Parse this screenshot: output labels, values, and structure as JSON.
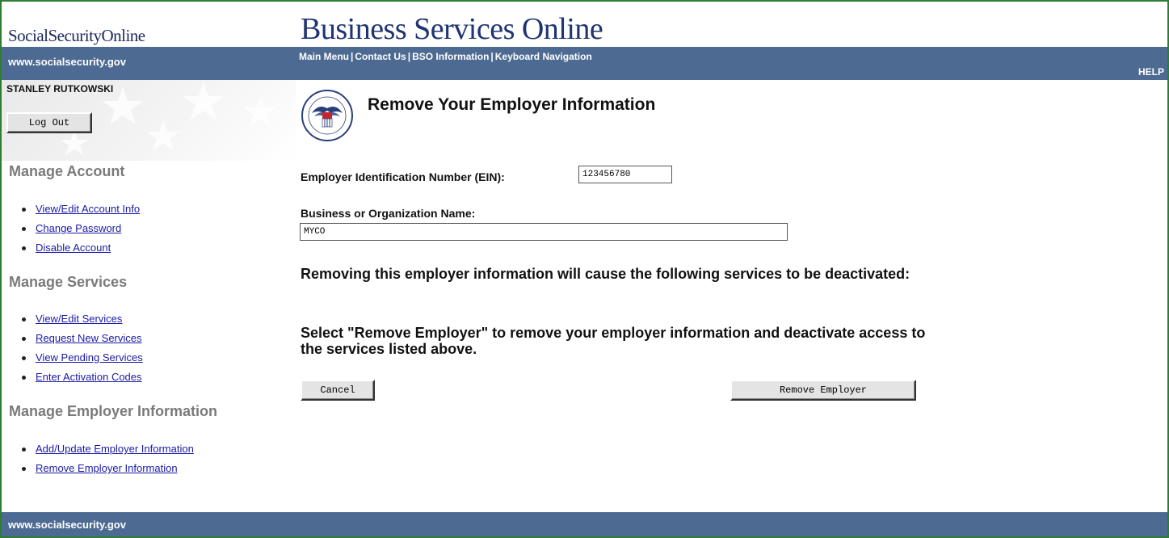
{
  "header": {
    "brand": "SocialSecurityOnline",
    "title": "Business Services Online",
    "url": "www.socialsecurity.gov",
    "nav": [
      "Main Menu",
      "Contact Us",
      "BSO Information",
      "Keyboard Navigation"
    ],
    "nav_separator": "|",
    "help": "HELP"
  },
  "sidebar": {
    "username": "STANLEY RUTKOWSKI",
    "logout_label": "Log Out",
    "sections": [
      {
        "heading": "Manage Account",
        "items": [
          "View/Edit Account Info",
          "Change Password",
          "Disable Account"
        ]
      },
      {
        "heading": "Manage Services",
        "items": [
          "View/Edit Services",
          "Request New Services",
          "View Pending Services",
          "Enter Activation Codes"
        ]
      },
      {
        "heading": "Manage Employer Information",
        "items": [
          "Add/Update Employer Information",
          "Remove Employer Information"
        ]
      }
    ]
  },
  "main": {
    "title": "Remove Your Employer Information",
    "ein_label": "Employer Identification Number (EIN):",
    "ein_value": "123456780",
    "name_label": "Business or Organization Name:",
    "name_value": "MYCO",
    "message1": "Removing this employer information will cause the following services to be deactivated:",
    "message2": "Select \"Remove Employer\" to remove your employer information and deactivate access to the services listed above.",
    "cancel_label": "Cancel",
    "remove_label": "Remove Employer"
  },
  "footer": {
    "url": "www.socialsecurity.gov"
  },
  "colors": {
    "bar": "#4d6a92",
    "title": "#1f3472",
    "link": "#1a1aa6",
    "border": "#2e7d32"
  },
  "icons": [
    "ssa-seal-icon"
  ]
}
